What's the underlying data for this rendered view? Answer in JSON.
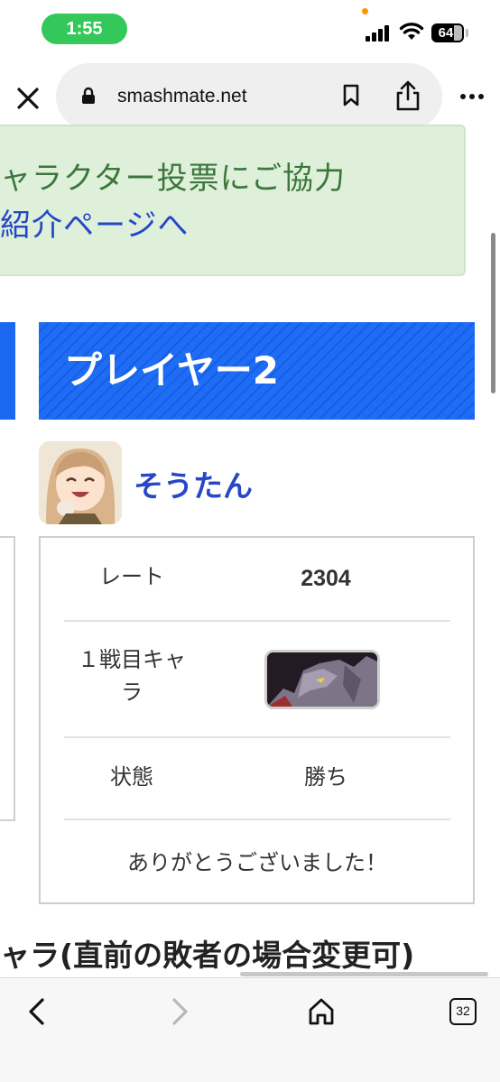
{
  "status_bar": {
    "time": "1:55",
    "battery": "64"
  },
  "browser": {
    "url": "smashmate.net",
    "tab_count": "32"
  },
  "notice": {
    "line1": "ャラクター投票にご協力",
    "line2": "紹介ページへ"
  },
  "player2": {
    "title": "プレイヤー2",
    "name": "そうたん",
    "rate_label": "レート",
    "rate_value": "2304",
    "character_label_line1": "１戦目キャ",
    "character_label_line2": "ラ",
    "status_label": "状態",
    "status_value": "勝ち",
    "message": "ありがとうございました！"
  },
  "section_heading": "ャラ(直前の敗者の場合変更可)",
  "colors": {
    "header_blue": "#1f6cf5",
    "notice_bg": "#def0d9",
    "notice_text": "#3c763d",
    "link_blue": "#2746c8",
    "time_pill": "#34c759"
  },
  "icons": [
    "signal-icon",
    "wifi-icon",
    "battery-icon",
    "close-icon",
    "lock-icon",
    "bookmark-icon",
    "share-icon",
    "more-icon",
    "back-icon",
    "forward-icon",
    "home-icon",
    "tabs-icon"
  ]
}
